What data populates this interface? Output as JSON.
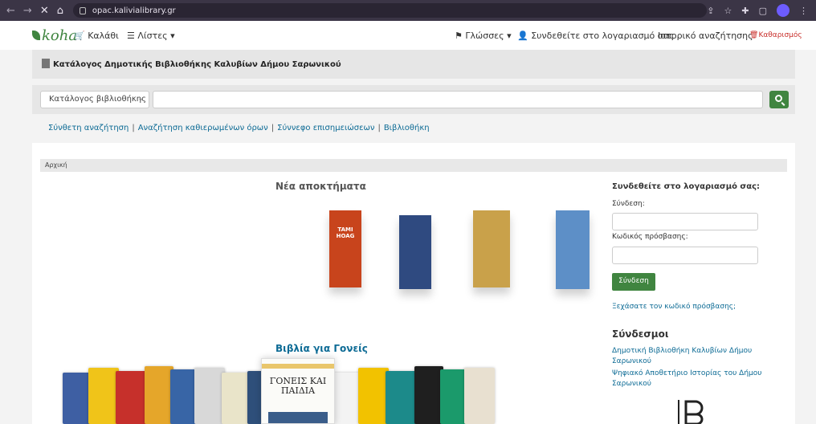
{
  "browser": {
    "url": "opac.kalivialibrary.gr",
    "back": "←",
    "forward": "→",
    "stop": "✕",
    "home": "⌂",
    "share": "⇪",
    "star": "☆",
    "extensions": "✚",
    "sidepanel": "▢",
    "menu": "⋮"
  },
  "topbar": {
    "logo": "koha",
    "cart": "Καλάθι",
    "lists": "Λίστες",
    "languages": "Γλώσσες",
    "login": "Συνδεθείτε στο λογαριασμό σας",
    "history": "Ιστορικό αναζήτησης",
    "clear": "Καθαρισμός"
  },
  "masthead": {
    "library": "Κατάλογος Δημοτικής Βιβλιοθήκης Καλυβίων Δήμου Σαρωνικού"
  },
  "search": {
    "selected": "Κατάλογος βιβλιοθήκης",
    "placeholder": ""
  },
  "moresearches": {
    "advanced": "Σύνθετη αναζήτηση",
    "authorities": "Αναζήτηση καθιερωμένων όρων",
    "tagcloud": "Σύννεφο επισημειώσεων",
    "library": "Βιβλιοθήκη"
  },
  "breadcrumb": "Αρχική",
  "new_acquisitions": {
    "title": "Νέα αποκτήματα",
    "covers": [
      {
        "text": "TAMI HOAG",
        "color": "#c8441c"
      },
      {
        "text": "",
        "color": "#2f4a80"
      },
      {
        "text": "",
        "color": "#c9a14a"
      },
      {
        "text": "",
        "color": "#5d8fc7"
      }
    ]
  },
  "parents_books": {
    "title": "Βιβλία για Γονείς",
    "featured": "ΓΟΝΕΙΣ ΚΑΙ ΠΑΙΔΙΑ",
    "colors": [
      "#3e5fa3",
      "#f0c419",
      "#c6302b",
      "#e5a62a",
      "#3865a6",
      "#d8d8d8",
      "#e9e4c9",
      "#2e4f7a",
      "#f3f3f3",
      "#f2c200",
      "#1c8a8a",
      "#1f1f1f",
      "#1b9a6b",
      "#e8e0d0"
    ]
  },
  "login_panel": {
    "title": "Συνδεθείτε στο λογαριασμό σας:",
    "user_label": "Σύνδεση:",
    "pass_label": "Κωδικός πρόσβασης:",
    "button": "Σύνδεση",
    "forgot": "Ξεχάσατε τον κωδικό πρόσβασης;"
  },
  "links_panel": {
    "title": "Σύνδεσμοι",
    "items": [
      "Δημοτική Βιβλιοθήκη Καλυβίων Δήμου Σαρωνικού",
      "Ψηφιακό Αποθετήριο Ιστορίας του Δήμου Σαρωνικού"
    ]
  }
}
